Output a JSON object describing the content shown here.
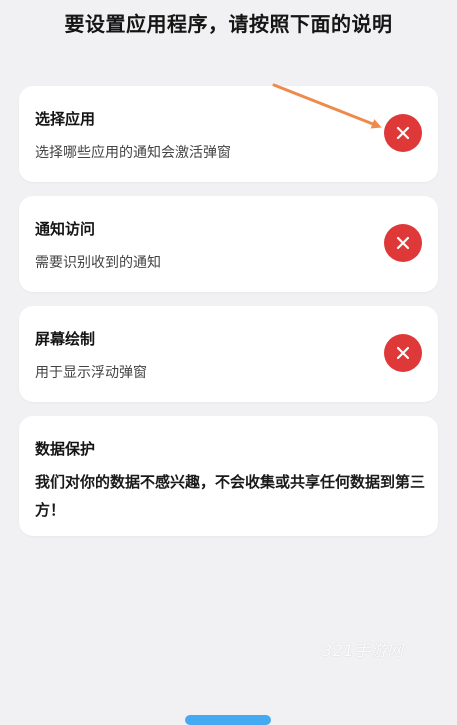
{
  "header": {
    "title": "要设置应用程序，请按照下面的说明"
  },
  "cards": [
    {
      "title": "选择应用",
      "desc": "选择哪些应用的通知会激活弹窗",
      "status_icon": "close-icon"
    },
    {
      "title": "通知访问",
      "desc": "需要识别收到的通知",
      "status_icon": "close-icon"
    },
    {
      "title": "屏幕绘制",
      "desc": "用于显示浮动弹窗",
      "status_icon": "close-icon"
    }
  ],
  "privacy": {
    "title": "数据保护",
    "body": "我们对你的数据不感兴趣，不会收集或共享任何数据到第三方！"
  },
  "watermark": "321手游网",
  "colors": {
    "background": "#f1f1f3",
    "card": "#ffffff",
    "status_red": "#de3838",
    "annotation_arrow": "#ee8a4c",
    "bottom_bar": "#45aaf2"
  }
}
